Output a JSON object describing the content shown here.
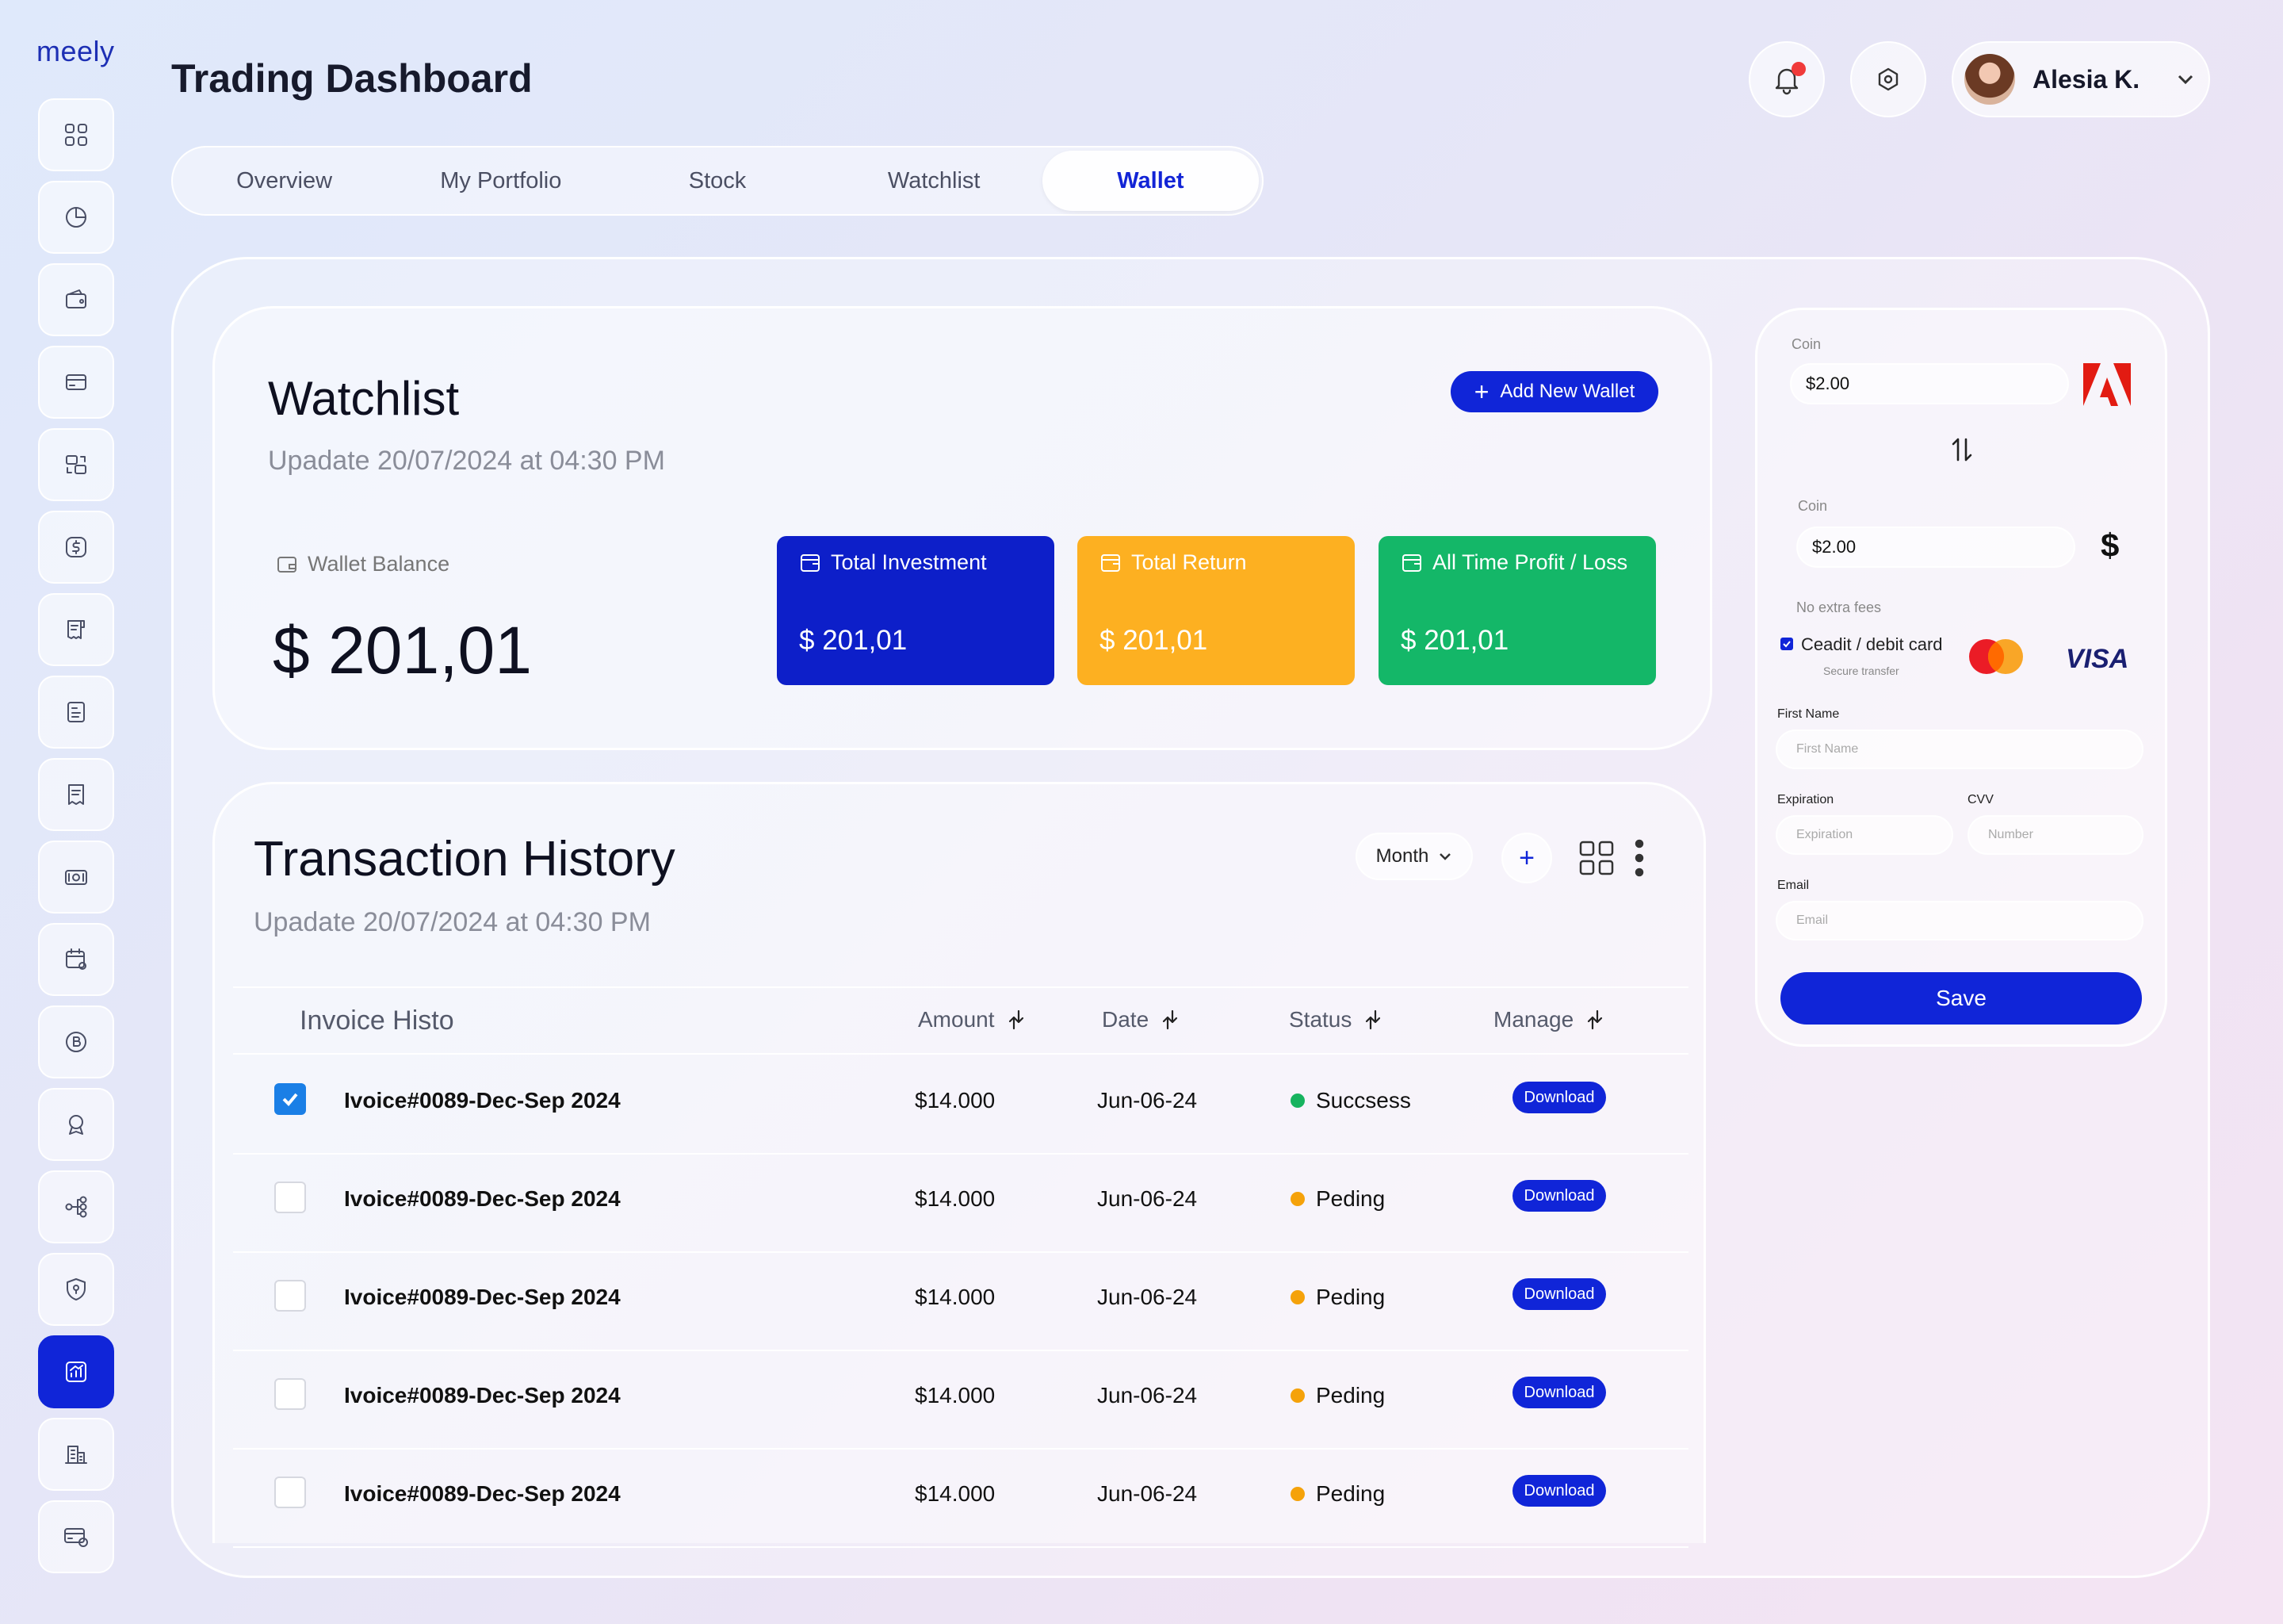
{
  "app": {
    "logo": "meely",
    "title": "Trading Dashboard"
  },
  "header": {
    "user_name": "Alesia K."
  },
  "tabs": [
    {
      "label": "Overview"
    },
    {
      "label": "My Portfolio"
    },
    {
      "label": "Stock"
    },
    {
      "label": "Watchlist"
    },
    {
      "label": "Wallet"
    }
  ],
  "active_tab": "Wallet",
  "watchlist": {
    "title": "Watchlist",
    "update": "Upadate 20/07/2024 at 04:30 PM",
    "add_button": "Add New Wallet",
    "wallet_balance_label": "Wallet Balance",
    "wallet_balance": "$ 201,01",
    "stats": [
      {
        "label": "Total Investment",
        "value": "$ 201,01",
        "color": "#0d1fc9"
      },
      {
        "label": "Total Return",
        "value": "$ 201,01",
        "color": "#fdb021"
      },
      {
        "label": "All Time Profit / Loss",
        "value": "$ 201,01",
        "color": "#14b768"
      }
    ]
  },
  "transactions": {
    "title": "Transaction History",
    "update": "Upadate 20/07/2024 at 04:30 PM",
    "filter": "Month",
    "columns": {
      "invoice": "Invoice Histo",
      "amount": "Amount",
      "date": "Date",
      "status": "Status",
      "manage": "Manage"
    },
    "download_label": "Download",
    "rows": [
      {
        "invoice": "Ivoice#0089-Dec-Sep 2024",
        "amount": "$14.000",
        "date": "Jun-06-24",
        "status": "Succsess",
        "status_color": "#17b35f",
        "checked": true
      },
      {
        "invoice": "Ivoice#0089-Dec-Sep 2024",
        "amount": "$14.000",
        "date": "Jun-06-24",
        "status": "Peding",
        "status_color": "#f5a20a",
        "checked": false
      },
      {
        "invoice": "Ivoice#0089-Dec-Sep 2024",
        "amount": "$14.000",
        "date": "Jun-06-24",
        "status": "Peding",
        "status_color": "#f5a20a",
        "checked": false
      },
      {
        "invoice": "Ivoice#0089-Dec-Sep 2024",
        "amount": "$14.000",
        "date": "Jun-06-24",
        "status": "Peding",
        "status_color": "#f5a20a",
        "checked": false
      },
      {
        "invoice": "Ivoice#0089-Dec-Sep 2024",
        "amount": "$14.000",
        "date": "Jun-06-24",
        "status": "Peding",
        "status_color": "#f5a20a",
        "checked": false
      }
    ]
  },
  "payment": {
    "coin1_label": "Coin",
    "coin1_value": "$2.00",
    "coin2_label": "Coin",
    "coin2_value": "$2.00",
    "dollar_sign": "$",
    "no_fees": "No extra fees",
    "card_option": "Ceadit / debit card",
    "secure": "Secure transfer",
    "visa": "VISA",
    "first_name_label": "First Name",
    "first_name_placeholder": "First Name",
    "expiration_label": "Expiration",
    "expiration_placeholder": "Expiration",
    "cvv_label": "CVV",
    "cvv_placeholder": "Number",
    "email_label": "Email",
    "email_placeholder": "Email",
    "save_label": "Save"
  },
  "colors": {
    "accent": "#1025d8",
    "success": "#17b35f",
    "pending": "#f5a20a"
  }
}
